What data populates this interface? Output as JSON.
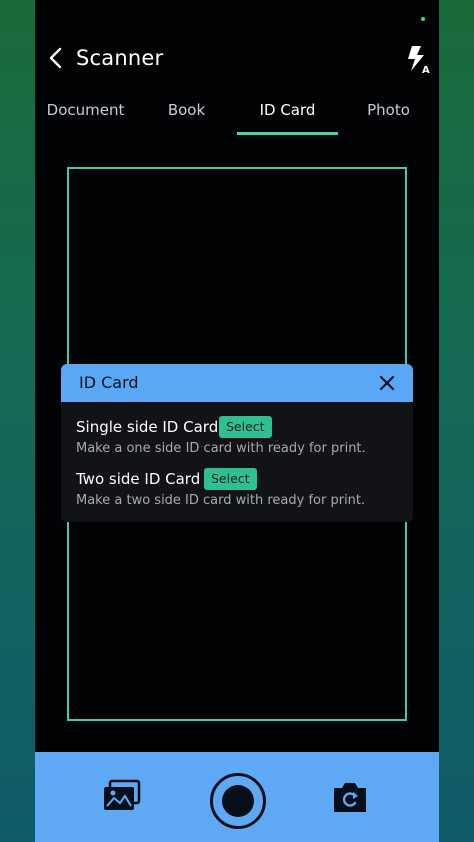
{
  "header": {
    "title": "Scanner",
    "back_icon": "chevron-left-icon",
    "flash_icon": "flash-auto-icon",
    "flash_badge": "A"
  },
  "tabs": [
    {
      "label": "Document",
      "active": false
    },
    {
      "label": "Book",
      "active": false
    },
    {
      "label": "ID Card",
      "active": true
    },
    {
      "label": "Photo",
      "active": false
    }
  ],
  "dialog": {
    "title": "ID Card",
    "close_icon": "close-icon",
    "options": [
      {
        "title": "Single side ID Card",
        "button": "Select",
        "description": "Make a one side ID card with ready for print."
      },
      {
        "title": "Two side ID Card",
        "button": "Select",
        "description": "Make a two side ID card with ready for print."
      }
    ]
  },
  "bottom_bar": {
    "gallery_icon": "gallery-icon",
    "shutter_icon": "shutter-button",
    "switch_icon": "camera-switch-icon"
  },
  "colors": {
    "accent": "#48d3b6",
    "dialog_header": "#5aa7f5",
    "bottom_bar": "#5ea8f4",
    "select_button": "#2fbf94"
  }
}
